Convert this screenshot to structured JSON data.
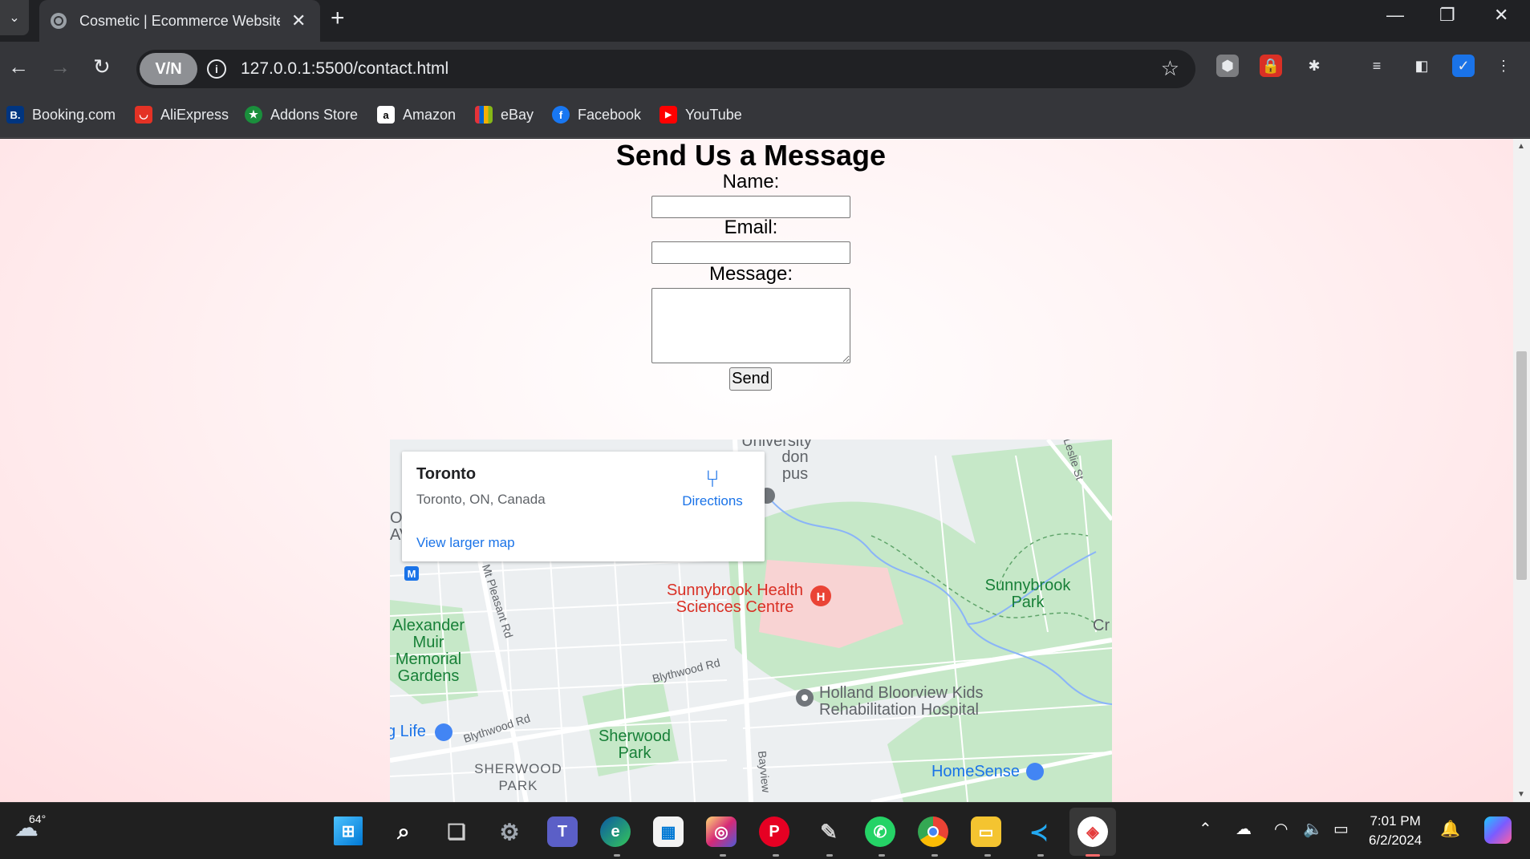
{
  "browser": {
    "tab_title": "Cosmetic | Ecommerce Website",
    "url": "127.0.0.1:5500/contact.html",
    "vpn_label": "V/N"
  },
  "bookmarks": [
    {
      "label": "Booking.com",
      "icon": "B.",
      "color": "#003580"
    },
    {
      "label": "AliExpress",
      "icon": "◡",
      "color": "#e43225"
    },
    {
      "label": "Addons Store",
      "icon": "★",
      "color": "#1a8f3c"
    },
    {
      "label": "Amazon",
      "icon": "a",
      "color": "#ffffff"
    },
    {
      "label": "eBay",
      "icon": "▬",
      "color": "#e53238"
    },
    {
      "label": "Facebook",
      "icon": "f",
      "color": "#1877f2"
    },
    {
      "label": "YouTube",
      "icon": "▶",
      "color": "#ff0000"
    }
  ],
  "form": {
    "title": "Send Us a Message",
    "name_label": "Name:",
    "email_label": "Email:",
    "message_label": "Message:",
    "send_label": "Send",
    "name_value": "",
    "email_value": "",
    "message_value": ""
  },
  "map": {
    "card_title": "Toronto",
    "card_subtitle": "Toronto, ON, Canada",
    "directions_label": "Directions",
    "view_larger": "View larger map",
    "places": {
      "university": "University",
      "campus_fragment": "don\npus",
      "sunnybrook_hospital": "Sunnybrook Health\nSciences Centre",
      "sunnybrook_park": "Sunnybrook\nPark",
      "alexander_muir": "Alexander\nMuir\nMemorial\nGardens",
      "holland_bloorview": "Holland Bloorview Kids\nRehabilitation Hospital",
      "sherwood_park": "Sherwood\nPark",
      "sherwood_park_area": "SHERWOOD\nPARK",
      "homesense": "HomeSense",
      "life": "g Life",
      "cr": "Cr",
      "on_fragment": "ON\nAV"
    },
    "roads": {
      "mt_pleasant": "Mt Pleasant Rd",
      "blythwood_1": "Blythwood Rd",
      "blythwood_2": "Blythwood Rd",
      "leslie": "Leslie St",
      "bayview": "Bayview"
    },
    "metro_badge": "M"
  },
  "taskbar": {
    "weather": "64°",
    "time": "7:01 PM",
    "date": "6/2/2024"
  }
}
